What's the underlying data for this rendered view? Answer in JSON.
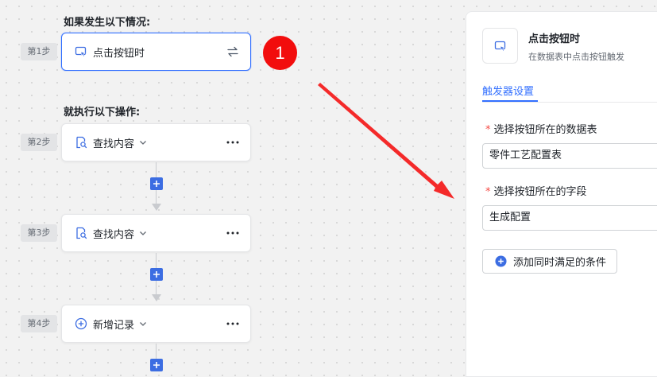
{
  "trigger_section": {
    "title": "如果发生以下情况:"
  },
  "action_section": {
    "title": "就执行以下操作:"
  },
  "steps": [
    {
      "label": "第1步",
      "text": "点击按钮时",
      "icon": "cursor-click-icon"
    },
    {
      "label": "第2步",
      "text": "查找内容",
      "icon": "search-doc-icon"
    },
    {
      "label": "第3步",
      "text": "查找内容",
      "icon": "search-doc-icon"
    },
    {
      "label": "第4步",
      "text": "新增记录",
      "icon": "plus-circle-icon"
    }
  ],
  "annotation": {
    "badge": "1"
  },
  "panel": {
    "title": "点击按钮时",
    "subtitle": "在数据表中点击按钮触发",
    "tab": "触发器设置",
    "field1": {
      "label": "选择按钮所在的数据表",
      "value": "零件工艺配置表"
    },
    "field2": {
      "label": "选择按钮所在的字段",
      "value": "生成配置"
    },
    "add_condition": "添加同时满足的条件"
  },
  "colors": {
    "accent": "#3370ff",
    "badge": "#f20d0d",
    "arrow": "#f42a2a"
  }
}
